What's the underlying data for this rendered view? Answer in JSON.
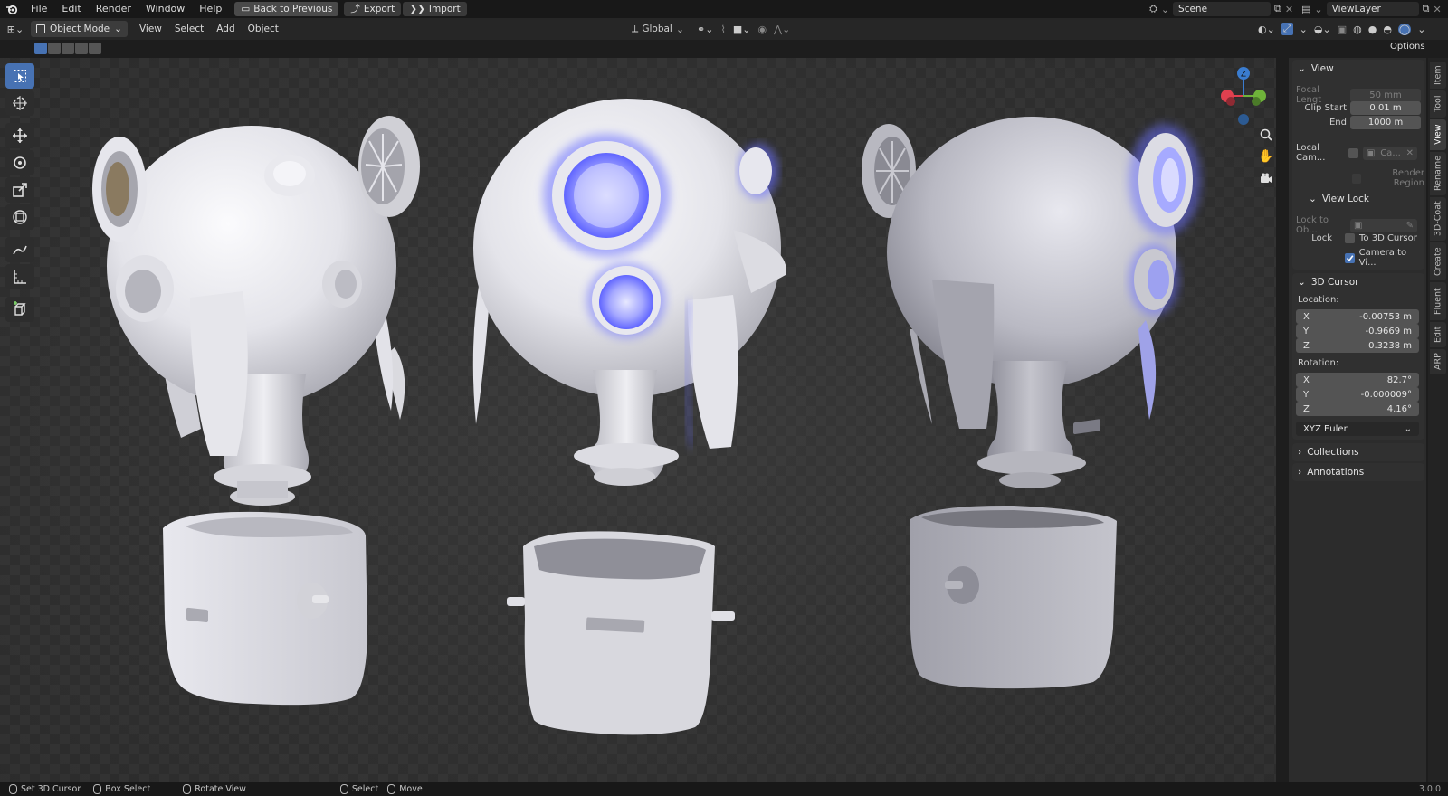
{
  "topbar": {
    "menus": [
      "File",
      "Edit",
      "Render",
      "Window",
      "Help"
    ],
    "back_label": "Back to Previous",
    "export_label": "Export",
    "import_label": "Import",
    "scene": "Scene",
    "view_layer": "ViewLayer"
  },
  "header": {
    "mode": "Object Mode",
    "menus": [
      "View",
      "Select",
      "Add",
      "Object"
    ],
    "orientation": "Global",
    "options": "Options"
  },
  "npanel": {
    "view": {
      "title": "View",
      "focal_label": "Focal Lengt",
      "focal_value": "50 mm",
      "clip_start_label": "Clip Start",
      "clip_start_value": "0.01 m",
      "end_label": "End",
      "end_value": "1000 m",
      "local_cam_label": "Local Cam...",
      "local_cam_value": "Ca...",
      "render_region": "Render Region",
      "view_lock_title": "View Lock",
      "lock_to_obj_label": "Lock to Ob...",
      "lock_label": "Lock",
      "to_3d_cursor": "To 3D Cursor",
      "camera_to_view": "Camera to Vi..."
    },
    "cursor": {
      "title": "3D Cursor",
      "location_label": "Location:",
      "loc_x_label": "X",
      "loc_x": "-0.00753 m",
      "loc_y_label": "Y",
      "loc_y": "-0.9669 m",
      "loc_z_label": "Z",
      "loc_z": "0.3238 m",
      "rotation_label": "Rotation:",
      "rot_x_label": "X",
      "rot_x": "82.7°",
      "rot_y_label": "Y",
      "rot_y": "-0.000009°",
      "rot_z_label": "Z",
      "rot_z": "4.16°",
      "rotation_mode": "XYZ Euler"
    },
    "collections": "Collections",
    "annotations": "Annotations"
  },
  "tabs": [
    "Item",
    "Tool",
    "View",
    "Rename",
    "3D-Coat",
    "Create",
    "Fluent",
    "Edit",
    "ARP"
  ],
  "gizmo": {
    "x": "X",
    "y": "Y",
    "z": "Z"
  },
  "status": {
    "set_cursor": "Set 3D Cursor",
    "box_select": "Box Select",
    "rotate_view": "Rotate View",
    "select": "Select",
    "move": "Move",
    "version": "3.0.0"
  },
  "colors": {
    "accent": "#4772b3",
    "glow": "#6a70ff",
    "x_axis": "#e0404f",
    "y_axis": "#6fb33a",
    "z_axis": "#3a7ccf"
  }
}
